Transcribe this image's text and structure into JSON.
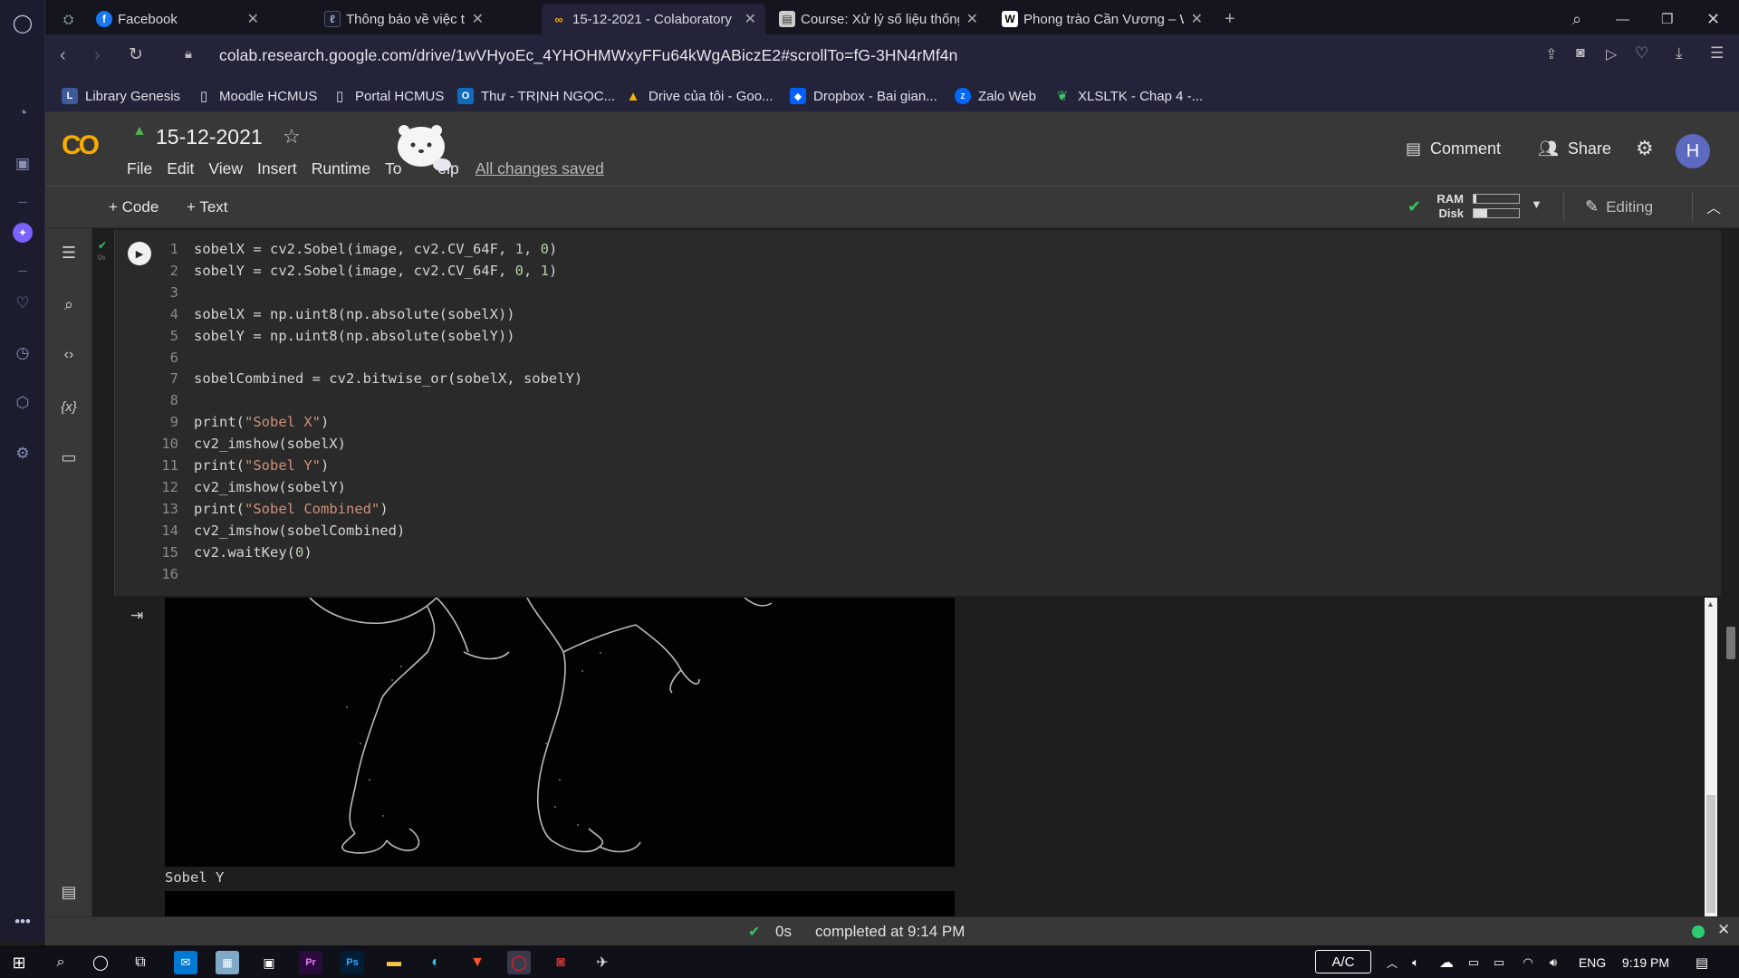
{
  "browser": {
    "tabs": [
      {
        "title": "Facebook",
        "icon": "facebook-icon",
        "color": "#1877f2"
      },
      {
        "title": "Thông báo về việc tra cứu l",
        "icon": "page-icon",
        "color": "#3b5998"
      },
      {
        "title": "15-12-2021 - Colaboratory",
        "icon": "colab-icon",
        "color": "#f9ab00",
        "active": true
      },
      {
        "title": "Course: Xử lý số liệu thống",
        "icon": "moodle-icon",
        "color": "#888888"
      },
      {
        "title": "Phong trào Cần Vương – W",
        "icon": "wikipedia-icon",
        "color": "#ffffff"
      }
    ],
    "url": "colab.research.google.com/drive/1wVHyoEc_4YHOHMWxyFFu64kWgABiczE2#scrollTo=fG-3HN4rMf4n",
    "bookmarks": [
      {
        "label": "Library Genesis",
        "icon": "libgen-icon"
      },
      {
        "label": "Moodle HCMUS",
        "icon": "page-icon"
      },
      {
        "label": "Portal HCMUS",
        "icon": "page-icon"
      },
      {
        "label": "Thư - TRỊNH NGỌC...",
        "icon": "outlook-icon"
      },
      {
        "label": "Drive của tôi - Goo...",
        "icon": "drive-icon"
      },
      {
        "label": "Dropbox - Bai gian...",
        "icon": "dropbox-icon"
      },
      {
        "label": "Zalo Web",
        "icon": "zalo-icon"
      },
      {
        "label": "XLSLTK - Chap 4 -...",
        "icon": "leaf-icon"
      }
    ]
  },
  "colab": {
    "logo": "CO",
    "notebook_title": "15-12-2021",
    "menu": [
      "File",
      "Edit",
      "View",
      "Insert",
      "Runtime",
      "To",
      "elp"
    ],
    "saved_status": "All changes saved",
    "comment_label": "Comment",
    "share_label": "Share",
    "avatar_letter": "H",
    "add_code": "+ Code",
    "add_text": "+ Text",
    "ram_label": "RAM",
    "disk_label": "Disk",
    "ram_fraction": 0.05,
    "disk_fraction": 0.3,
    "editing_label": "Editing",
    "exec_time_small": "0s"
  },
  "code_lines": [
    {
      "n": "1",
      "segs": [
        {
          "t": "sobelX = cv2.Sobel(image, cv2.CV_64F, "
        },
        {
          "t": "1",
          "c": "num"
        },
        {
          "t": ", "
        },
        {
          "t": "0",
          "c": "num"
        },
        {
          "t": ")"
        }
      ]
    },
    {
      "n": "2",
      "segs": [
        {
          "t": "sobelY = cv2.Sobel(image, cv2.CV_64F, "
        },
        {
          "t": "0",
          "c": "num"
        },
        {
          "t": ", "
        },
        {
          "t": "1",
          "c": "num"
        },
        {
          "t": ")"
        }
      ]
    },
    {
      "n": "3",
      "segs": []
    },
    {
      "n": "4",
      "segs": [
        {
          "t": "sobelX = np.uint8(np.absolute(sobelX))"
        }
      ]
    },
    {
      "n": "5",
      "segs": [
        {
          "t": "sobelY = np.uint8(np.absolute(sobelY))"
        }
      ]
    },
    {
      "n": "6",
      "segs": []
    },
    {
      "n": "7",
      "segs": [
        {
          "t": "sobelCombined = cv2.bitwise_or(sobelX, sobelY)"
        }
      ]
    },
    {
      "n": "8",
      "segs": []
    },
    {
      "n": "9",
      "segs": [
        {
          "t": "print("
        },
        {
          "t": "\"Sobel X\"",
          "c": "str"
        },
        {
          "t": ")"
        }
      ]
    },
    {
      "n": "10",
      "segs": [
        {
          "t": "cv2_imshow(sobelX)"
        }
      ]
    },
    {
      "n": "11",
      "segs": [
        {
          "t": "print("
        },
        {
          "t": "\"Sobel Y\"",
          "c": "str"
        },
        {
          "t": ")"
        }
      ]
    },
    {
      "n": "12",
      "segs": [
        {
          "t": "cv2_imshow(sobelY)"
        }
      ]
    },
    {
      "n": "13",
      "segs": [
        {
          "t": "print("
        },
        {
          "t": "\"Sobel Combined\"",
          "c": "str"
        },
        {
          "t": ")"
        }
      ]
    },
    {
      "n": "14",
      "segs": [
        {
          "t": "cv2_imshow(sobelCombined)"
        }
      ]
    },
    {
      "n": "15",
      "segs": [
        {
          "t": "cv2.waitKey("
        },
        {
          "t": "0",
          "c": "num"
        },
        {
          "t": ")"
        }
      ]
    },
    {
      "n": "16",
      "segs": []
    }
  ],
  "output": {
    "caption": "Sobel Y"
  },
  "status": {
    "time": "0s",
    "completed": "completed at 9:14 PM"
  },
  "taskbar": {
    "ac": "A/C",
    "lang": "ENG",
    "clock": "9:19 PM"
  },
  "colors": {
    "accent_blue": "#5c6bc0",
    "colab_orange": "#f9ab00",
    "success_green": "#2ecc71",
    "string": "#ce9178",
    "number": "#b5cea8"
  }
}
